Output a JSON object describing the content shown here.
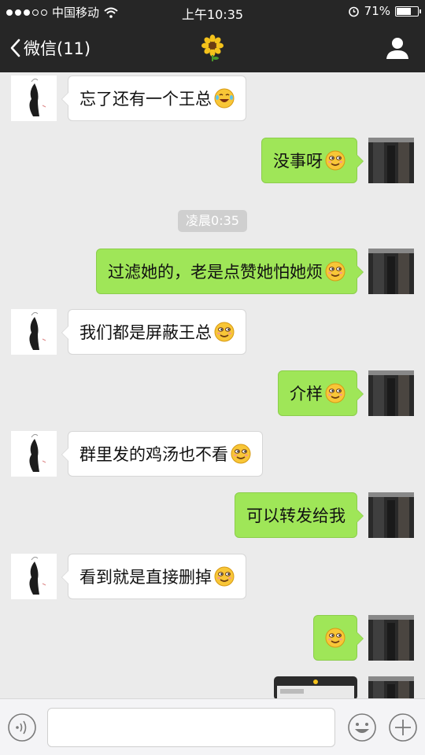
{
  "status": {
    "carrier": "中国移动",
    "time": "上午10:35",
    "battery": "71%",
    "battery_level": 0.71
  },
  "nav": {
    "back_label": "微信(11)",
    "title_icon": "sunflower-icon",
    "profile_icon": "person-icon"
  },
  "messages": [
    {
      "side": "in",
      "text": "忘了还有一个王总",
      "emoji": "laughing-tears"
    },
    {
      "side": "out",
      "text": "没事呀",
      "emoji": "smug-smile"
    },
    {
      "side": "out",
      "text": "过滤她的，老是点赞她怕她烦",
      "emoji": "smug-smile"
    },
    {
      "side": "in",
      "text": "我们都是屏蔽王总",
      "emoji": "smug-smile"
    },
    {
      "side": "out",
      "text": "介样",
      "emoji": "smug-smile"
    },
    {
      "side": "in",
      "text": "群里发的鸡汤也不看",
      "emoji": "smug-smile"
    },
    {
      "side": "out",
      "text": "可以转发给我",
      "emoji": ""
    },
    {
      "side": "in",
      "text": "看到就是直接删掉",
      "emoji": "smug-smile"
    },
    {
      "side": "out",
      "text": "",
      "emoji": "smug-smile"
    }
  ],
  "timestamp": "凌晨0:35",
  "input": {
    "voice_icon": "voice-icon",
    "emoji_icon": "emoji-face-icon",
    "plus_icon": "plus-icon",
    "value": ""
  },
  "colors": {
    "bar": "#262626",
    "out_bubble": "#9fe658",
    "in_bubble": "#ffffff",
    "chat_bg": "#ebebeb"
  }
}
